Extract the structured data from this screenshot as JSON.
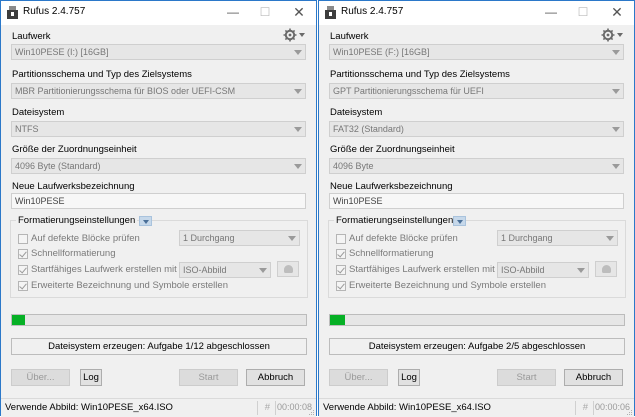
{
  "windows": [
    {
      "title": "Rufus 2.4.757",
      "device_label": "Laufwerk",
      "device_value": "Win10PESE (I:) [16GB]",
      "partition_label": "Partitionsschema und Typ des Zielsystems",
      "partition_value": "MBR Partitionierungsschema für BIOS oder UEFI-CSM",
      "filesystem_label": "Dateisystem",
      "filesystem_value": "NTFS",
      "cluster_label": "Größe der Zuordnungseinheit",
      "cluster_value": "4096 Byte (Standard)",
      "volume_label": "Neue Laufwerksbezeichnung",
      "volume_value": "Win10PESE",
      "format_options_title": "Formatierungseinstellungen",
      "bad_blocks_label": "Auf defekte Blöcke prüfen",
      "bad_blocks_checked": false,
      "passes_value": "1 Durchgang",
      "quick_format_label": "Schnellformatierung",
      "quick_format_checked": true,
      "bootable_label": "Startfähiges Laufwerk erstellen mit",
      "bootable_checked": true,
      "boot_type_value": "ISO-Abbild",
      "extended_label_label": "Erweiterte Bezeichnung und Symbole erstellen",
      "extended_label_checked": true,
      "progress_fraction": 0.045,
      "status_text": "Dateisystem erzeugen: Aufgabe 1/12 abgeschlossen",
      "about_button": "Über...",
      "log_button": "Log",
      "start_button": "Start",
      "cancel_button": "Abbruch",
      "statusbar_text": "Verwende Abbild: Win10PESE_x64.ISO",
      "statusbar_hash": "#",
      "elapsed_time": "00:00:08"
    },
    {
      "title": "Rufus 2.4.757",
      "device_label": "Laufwerk",
      "device_value": "Win10PESE (F:) [16GB]",
      "partition_label": "Partitionsschema und Typ des Zielsystems",
      "partition_value": "GPT Partitionierungsschema für UEFI",
      "filesystem_label": "Dateisystem",
      "filesystem_value": "FAT32 (Standard)",
      "cluster_label": "Größe der Zuordnungseinheit",
      "cluster_value": "4096 Byte",
      "volume_label": "Neue Laufwerksbezeichnung",
      "volume_value": "Win10PESE",
      "format_options_title": "Formatierungseinstellungen",
      "bad_blocks_label": "Auf defekte Blöcke prüfen",
      "bad_blocks_checked": false,
      "passes_value": "1 Durchgang",
      "quick_format_label": "Schnellformatierung",
      "quick_format_checked": true,
      "bootable_label": "Startfähiges Laufwerk erstellen mit",
      "bootable_checked": true,
      "boot_type_value": "ISO-Abbild",
      "extended_label_label": "Erweiterte Bezeichnung und Symbole erstellen",
      "extended_label_checked": true,
      "progress_fraction": 0.05,
      "status_text": "Dateisystem erzeugen: Aufgabe 2/5 abgeschlossen",
      "about_button": "Über...",
      "log_button": "Log",
      "start_button": "Start",
      "cancel_button": "Abbruch",
      "statusbar_text": "Verwende Abbild: Win10PESE_x64.ISO",
      "statusbar_hash": "#",
      "elapsed_time": "00:00:06"
    }
  ],
  "colors": {
    "progress_fill": "#06b025",
    "window_border": "#2b78c9",
    "dialog_bg": "#f0f0f0"
  },
  "icons": {
    "app": "usb-drive-icon",
    "settings": "gear-icon",
    "minimize": "minimize-icon",
    "maximize": "maximize-icon",
    "close": "close-icon",
    "expand": "chevron-down-icon",
    "hash": "hash-icon",
    "disk": "disk-icon",
    "grip": "resize-grip-icon"
  }
}
